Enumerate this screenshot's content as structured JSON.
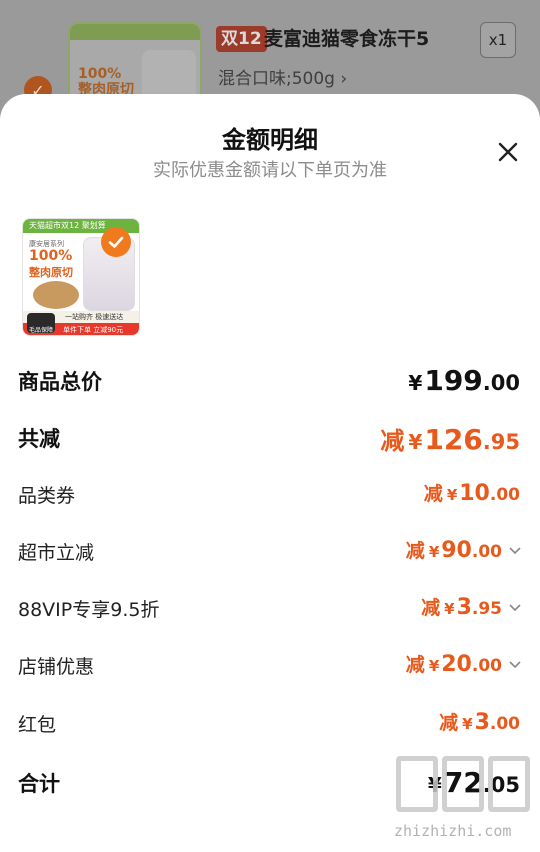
{
  "background_item": {
    "check": "✓",
    "badge": "双12",
    "title": "麦富迪猫零食冻干5",
    "spec": "混合口味;500g ›",
    "qty": "x1",
    "thumb_text": "100%\n整肉原切"
  },
  "sheet": {
    "title": "金额明细",
    "subtitle": "实际优惠金额请以下单页为准"
  },
  "thumb": {
    "top_bar": "天猫超市双12 聚划算",
    "series": "康安居系列",
    "pct": "100%",
    "cut": "整肉原切",
    "strip": "一站购齐 极速送达",
    "footer": "单件下单 立减90元",
    "logo": "毛品保障"
  },
  "rows": [
    {
      "label": "商品总价",
      "prefix": "",
      "yen": "¥",
      "int": "199",
      "dec": ".00"
    },
    {
      "label": "共减",
      "prefix": "减",
      "yen": "¥",
      "int": "126",
      "dec": ".95"
    },
    {
      "label": "品类券",
      "prefix": "减",
      "yen": "¥",
      "int": "10",
      "dec": ".00"
    },
    {
      "label": "超市立减",
      "prefix": "减",
      "yen": "¥",
      "int": "90",
      "dec": ".00"
    },
    {
      "label": "88VIP专享9.5折",
      "prefix": "减",
      "yen": "¥",
      "int": "3",
      "dec": ".95"
    },
    {
      "label": "店铺优惠",
      "prefix": "减",
      "yen": "¥",
      "int": "20",
      "dec": ".00"
    },
    {
      "label": "红包",
      "prefix": "减",
      "yen": "¥",
      "int": "3",
      "dec": ".00"
    },
    {
      "label": "合计",
      "prefix": "",
      "yen": "¥",
      "int": "72",
      "dec": ".05"
    }
  ],
  "watermark": {
    "site": "zhizhizhi.com"
  },
  "colors": {
    "accent": "#e8591c",
    "text": "#111111",
    "muted": "#8c8c8c"
  }
}
